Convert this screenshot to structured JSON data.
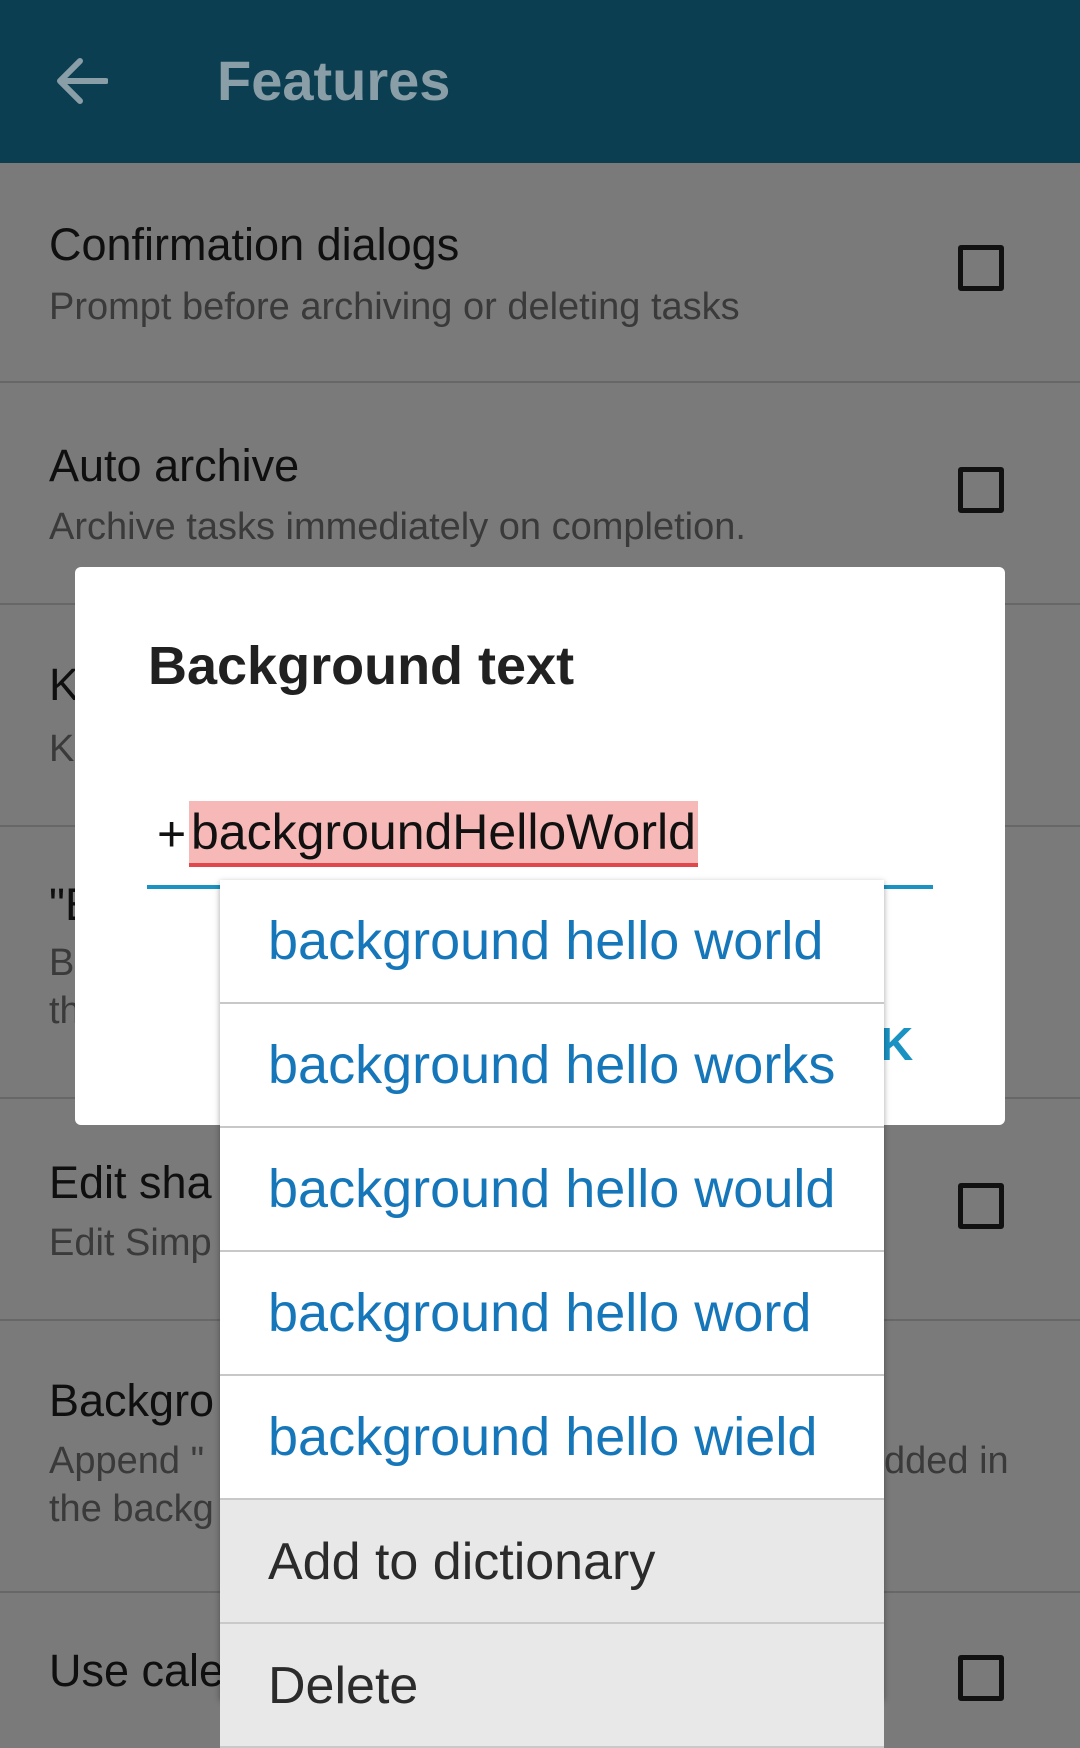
{
  "appbar": {
    "title": "Features",
    "back_icon": "arrow-back-icon"
  },
  "settings": [
    {
      "title": "Confirmation dialogs",
      "subtitle": "Prompt before archiving or deleting tasks",
      "checked": false
    },
    {
      "title": "Auto archive",
      "subtitle": "Archive tasks immediately on completion.",
      "checked": false
    },
    {
      "title": "K",
      "subtitle": "K",
      "checked": true
    },
    {
      "title": "\"E",
      "subtitle_line1": "B",
      "subtitle_line2": "th",
      "checked": true
    },
    {
      "title": "Edit sha",
      "subtitle": "Edit Simp",
      "checked": false
    },
    {
      "title": "Backgro",
      "subtitle_line1": "Append \"",
      "subtitle_line1_right": "dded in",
      "subtitle_line2": "the backg",
      "checked": false
    },
    {
      "title": "Use cale",
      "checked": false
    }
  ],
  "dialog": {
    "title": "Background text",
    "input_prefix": "+",
    "input_word": "backgroundHelloWorld",
    "button_fragment": "K"
  },
  "suggestions": [
    "background hello world",
    "background hello works",
    "background hello would",
    "background hello word",
    "background hello wield"
  ],
  "actions": [
    "Add to dictionary",
    "Delete"
  ],
  "colors": {
    "appbar": "#0b3e50",
    "accent": "#1a93c2",
    "suggestion_text": "#1577b9",
    "misspell_bg": "#f6b9b7"
  }
}
